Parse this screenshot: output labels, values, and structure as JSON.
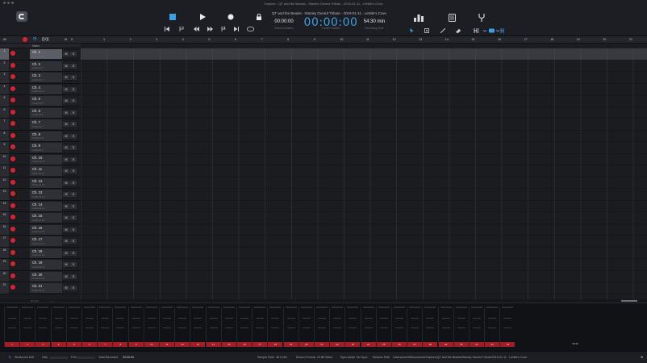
{
  "window": {
    "title": "Capture - QT and the Beasts - Stanley Gerard Tribute - 2019-01-11 - LeNite's Cove"
  },
  "transport": {
    "session_name": "QT and the Beasts - Stanley Gerard Tribute - 2019-01-11 - LeNite's Cove",
    "record_duration": "00:00:00",
    "record_duration_label": "Record Duration",
    "current_position": "00:00:00",
    "current_position_label": "Current Position",
    "remaining_time": "54:30 min",
    "remaining_time_label": "Remaining Time"
  },
  "ruler": {
    "all_label": "All",
    "bars": [
      "1",
      "2",
      "3",
      "4",
      "5",
      "6",
      "7",
      "8",
      "9",
      "10",
      "11",
      "12",
      "13",
      "14",
      "15",
      "16",
      "17",
      "18",
      "19",
      "20",
      "21"
    ]
  },
  "track_header": {
    "name_col": "Name",
    "m": "M",
    "s": "S"
  },
  "tracks": [
    {
      "num": "1",
      "name": "Ch. 1",
      "sub": "Channel 1"
    },
    {
      "num": "2",
      "name": "Ch. 2",
      "sub": "Channel 2"
    },
    {
      "num": "3",
      "name": "Ch. 3",
      "sub": "Channel 3"
    },
    {
      "num": "4",
      "name": "Ch. 4",
      "sub": "Channel 4"
    },
    {
      "num": "5",
      "name": "Ch. 5",
      "sub": "Channel 5"
    },
    {
      "num": "6",
      "name": "Ch. 6",
      "sub": "Channel 6"
    },
    {
      "num": "7",
      "name": "Ch. 7",
      "sub": "Channel 7"
    },
    {
      "num": "8",
      "name": "Ch. 8",
      "sub": "Channel 8"
    },
    {
      "num": "9",
      "name": "Ch. 9",
      "sub": "Channel 9"
    },
    {
      "num": "10",
      "name": "Ch. 10",
      "sub": "Channel 10"
    },
    {
      "num": "11",
      "name": "Ch. 11",
      "sub": "Channel 11"
    },
    {
      "num": "12",
      "name": "Ch. 12",
      "sub": "Channel 12"
    },
    {
      "num": "13",
      "name": "Ch. 13",
      "sub": "Channel 13"
    },
    {
      "num": "14",
      "name": "Ch. 14",
      "sub": "Channel 14"
    },
    {
      "num": "15",
      "name": "Ch. 15",
      "sub": "Channel 15"
    },
    {
      "num": "16",
      "name": "Ch. 16",
      "sub": "Channel 16"
    },
    {
      "num": "17",
      "name": "Ch. 17",
      "sub": "Channel 17"
    },
    {
      "num": "18",
      "name": "Ch. 18",
      "sub": "Channel 18"
    },
    {
      "num": "19",
      "name": "Ch. 19",
      "sub": "Channel 19"
    },
    {
      "num": "20",
      "name": "Ch. 20",
      "sub": "Channel 20"
    },
    {
      "num": "21",
      "name": "Ch. 21",
      "sub": "Channel 21"
    }
  ],
  "scroll": {
    "label": "Normal"
  },
  "mixer": {
    "channels": [
      "1",
      "2",
      "3",
      "4",
      "5",
      "6",
      "7",
      "8",
      "9",
      "10",
      "11",
      "12",
      "13",
      "14",
      "15",
      "16",
      "17",
      "18",
      "19",
      "20",
      "21",
      "22",
      "23",
      "24",
      "25",
      "26",
      "27",
      "28",
      "29",
      "30",
      "31",
      "32",
      "33"
    ],
    "master_label": "33-34"
  },
  "status": {
    "device": "StudioLive 64S",
    "disk_label": "Disk",
    "free_label": "Free",
    "total_recorded_label": "Total Recorded",
    "total_recorded": "00:00:00",
    "sample_rate_label": "Sample Rate",
    "sample_rate": "48.0 kHz",
    "record_format_label": "Record Format",
    "record_format": "24 Bit Wave",
    "sync_mode_label": "Sync Mode",
    "sync_mode": "No Sync",
    "session_path_label": "Session Path",
    "session_path": "/Users/cwrnlt/Documents/Capture/QT and the Beasts/Stanley Gerard Tribute/2019-01-11 - LeNite's Cove"
  },
  "colors": {
    "accent": "#3aa0e0",
    "record": "#d8232a",
    "mixer_red": "#a21d24"
  }
}
